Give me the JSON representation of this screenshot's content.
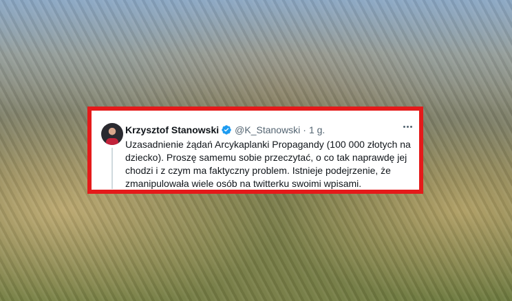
{
  "tweet": {
    "author_name": "Krzysztof Stanowski",
    "handle": "@K_Stanowski",
    "separator": "·",
    "time": "1 g.",
    "text": "Uzasadnienie żądań Arcykaplanki Propagandy (100 000 złotych na dziecko). Proszę samemu sobie przeczytać, o co tak naprawdę jej chodzi i z czym ma faktyczny problem. Istnieje podejrzenie, że zmanipulowała wiele osób na twitterku swoimi wpisami.",
    "verified": true,
    "verified_icon": "verified-badge-icon",
    "more_icon": "more-horizontal-icon"
  },
  "colors": {
    "frame_border": "#e41a1a",
    "verified_badge": "#1d9bf0",
    "text_primary": "#0f1419",
    "text_secondary": "#536471"
  }
}
